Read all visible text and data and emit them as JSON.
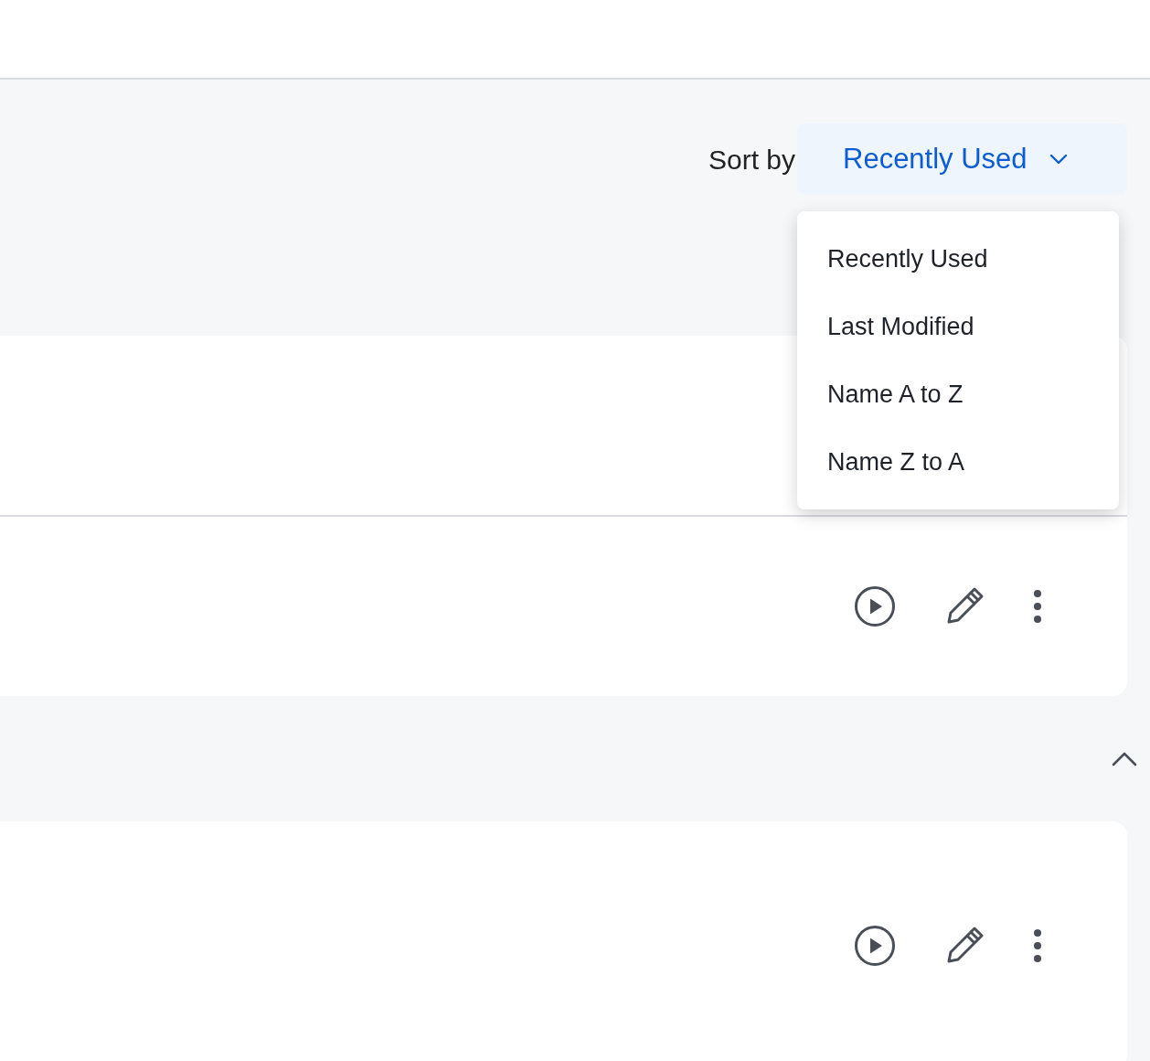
{
  "sort": {
    "label": "Sort by",
    "value": "Recently Used",
    "expanded": true,
    "options": [
      {
        "label": "Recently Used"
      },
      {
        "label": "Last Modified"
      },
      {
        "label": "Name A to Z"
      },
      {
        "label": "Name Z to A"
      }
    ]
  },
  "sections": [
    {
      "rows": [
        {
          "kind": "blank"
        },
        {
          "kind": "actions"
        }
      ]
    },
    {
      "expanded": true,
      "rows": [
        {
          "kind": "actions"
        }
      ]
    }
  ]
}
